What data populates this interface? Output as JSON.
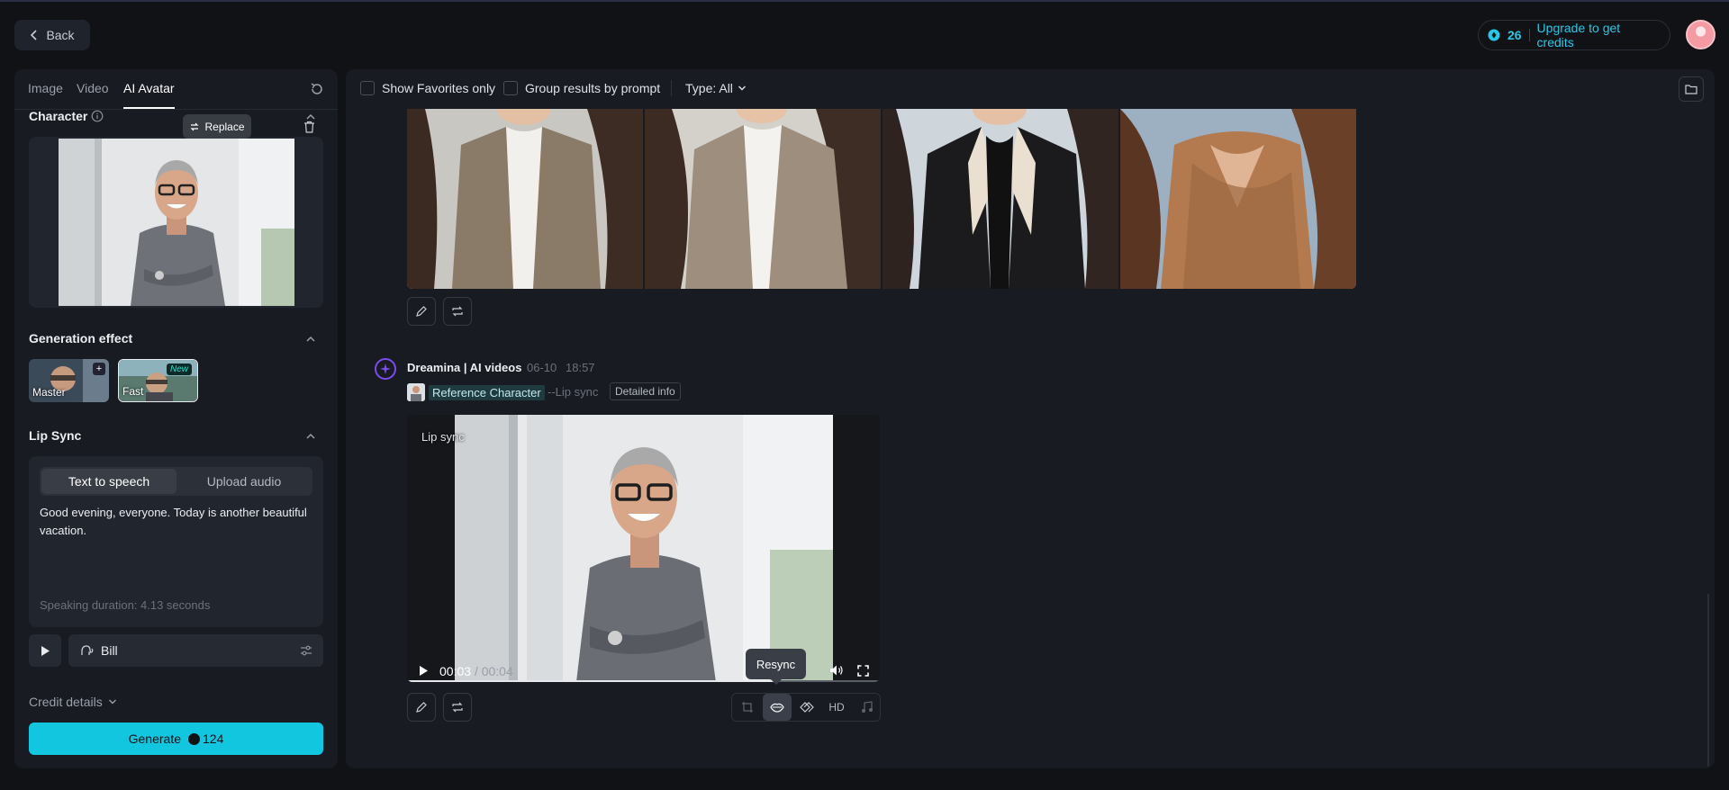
{
  "header": {
    "back_label": "Back",
    "credits": "26",
    "upgrade_label": "Upgrade to get credits"
  },
  "left_panel": {
    "tabs": [
      {
        "label": "Image"
      },
      {
        "label": "Video"
      },
      {
        "label": "AI Avatar",
        "active": true
      }
    ],
    "character": {
      "title": "Character",
      "replace_label": "Replace"
    },
    "generation_effect": {
      "title": "Generation effect",
      "options": [
        {
          "label": "Master",
          "badge": "+"
        },
        {
          "label": "Fast",
          "badge": "New",
          "selected": true
        }
      ]
    },
    "lip_sync": {
      "title": "Lip Sync",
      "modes": [
        "Text to speech",
        "Upload audio"
      ],
      "active_mode": "Text to speech",
      "text": "Good evening, everyone. Today is another beautiful vacation.",
      "duration": "Speaking duration: 4.13 seconds",
      "voice": "Bill"
    },
    "credit_details_label": "Credit details",
    "generate": {
      "label": "Generate",
      "cost": "124"
    }
  },
  "main": {
    "toolbar": {
      "favorites_label": "Show Favorites only",
      "group_label": "Group results by prompt",
      "type_label": "Type: All"
    },
    "generation": {
      "author": "Dreamina | AI videos",
      "date": "06-10",
      "time": "18:57",
      "reference_label": "Reference Character",
      "mode_tag": "--Lip sync",
      "detail_label": "Detailed info"
    },
    "video": {
      "overlay_label": "Lip sync",
      "current_time": "00:03",
      "total_time": "/ 00:04",
      "progress": 0.785
    },
    "actions": {
      "tooltip": "Resync",
      "hd_label": "HD"
    }
  },
  "colors": {
    "accent": "#12c6e0",
    "background": "#101216",
    "panel": "#181b21",
    "purple": "#7d4cf0"
  }
}
